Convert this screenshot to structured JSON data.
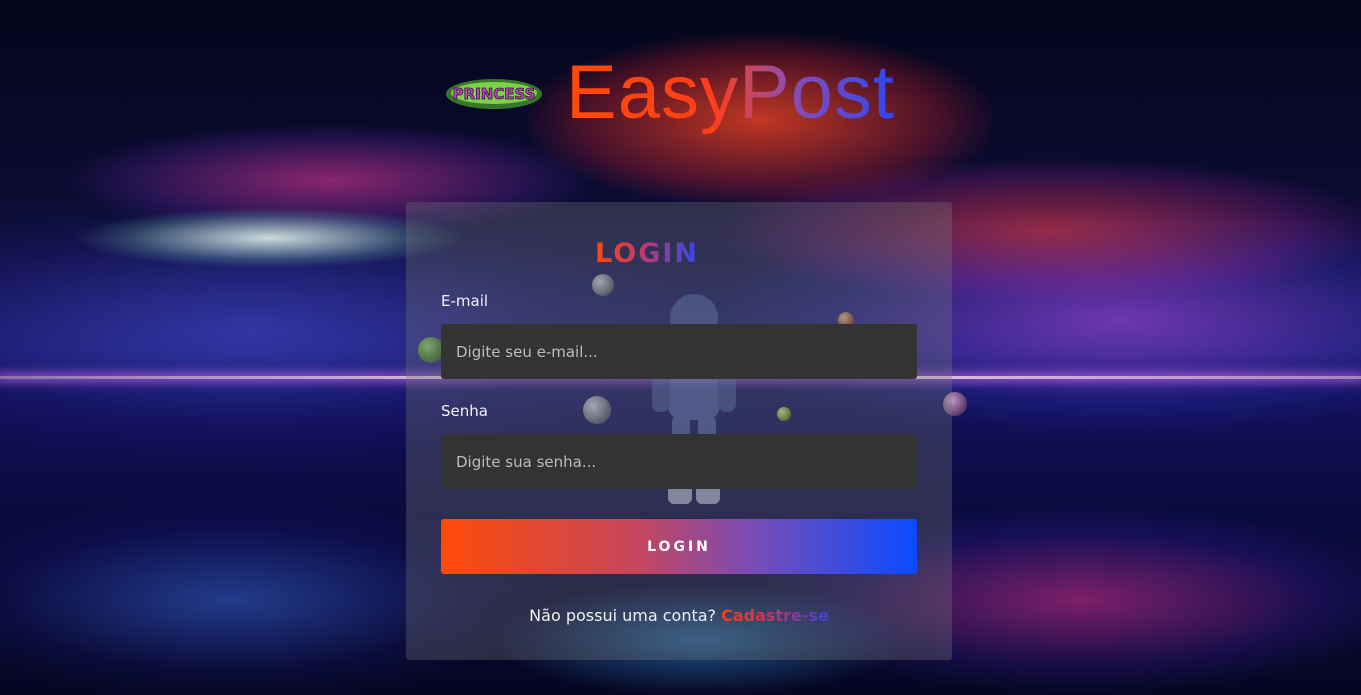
{
  "header": {
    "logo_text": "PRINCESS",
    "brand": "EasyPost"
  },
  "login_card": {
    "title": "LOGIN",
    "email": {
      "label": "E-mail",
      "placeholder": "Digite seu e-mail...",
      "value": ""
    },
    "password": {
      "label": "Senha",
      "placeholder": "Digite sua senha...",
      "value": ""
    },
    "submit_label": "LOGIN",
    "signup_prompt": "Não possui uma conta?",
    "signup_link": "Cadastre-se"
  },
  "colors": {
    "gradient_start": "#ff4a08",
    "gradient_end": "#0a4bff",
    "input_bg": "#333333",
    "card_bg": "rgba(120,120,120,0.32)"
  },
  "icons": {
    "logo": "princess-graffiti-logo"
  }
}
